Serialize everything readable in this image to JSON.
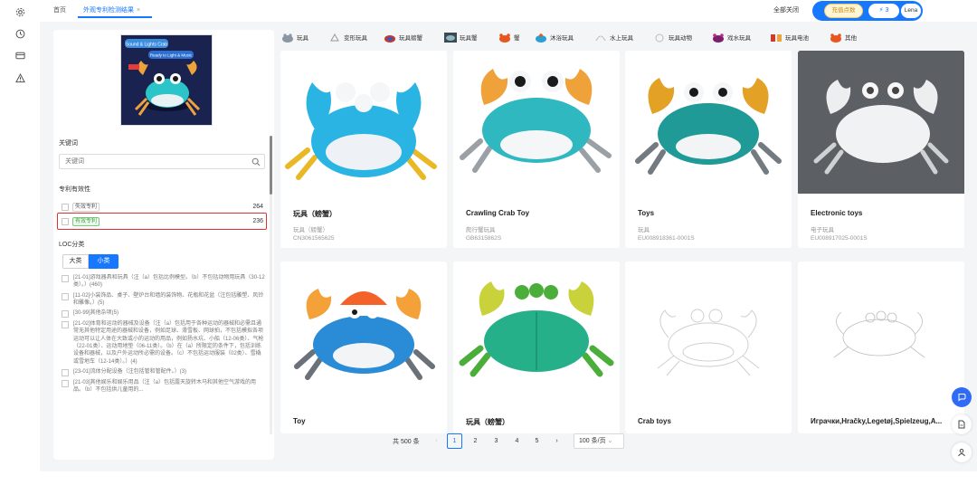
{
  "tabs": [
    {
      "label": "首页",
      "active": false
    },
    {
      "label": "外观专利检测结果",
      "active": true,
      "close": "×"
    }
  ],
  "top_right": {
    "close_all": "全部关闭",
    "points_label": "充值点数",
    "bolt_count": "3",
    "user": "Lena"
  },
  "filter": {
    "keyword_label": "关键词",
    "keyword_placeholder": "关键词",
    "validity_label": "专利有效性",
    "validity_options": [
      {
        "label": "失效专利",
        "count": "264"
      },
      {
        "label": "有效专利",
        "count": "236"
      }
    ],
    "loc_label": "LOC分类",
    "loc_tabs": [
      "大类",
      "小类"
    ],
    "loc_items": [
      "[21-01]游戏器具和玩具（注（a）包括比例模型。（b）不包括动物用玩具（30-12类）。）(460)",
      "[11-02]小装饰品、桌子、壁炉台和墙的装饰物、花瓶和花盆（注包括雕塑、风铃和雕像。）(5)",
      "[30-99]其他杂项(5)",
      "[21-02]体育和运动的器械及设备（注（a）包括用于各种运动的器械和必需且通常无其他特定用途的器械和设备，例如足球、滑雪板、网球拍，不包括模拟各项运动可以让人体在大致或小的运动的用品，例如扬水坑、小船（12-06类）、气枪（22-01类）、运动用地垫（06-11类）。（b）在（a）所限定的条件下，包括训练设备和器械，以及户外运动所必需的设备。（c）不包括运动服装（02类）、雪橇或雪地车（12-14类）。）(4)",
      "[23-01]流体分配设备（注包括管和管配件。）(3)",
      "[21-03]其他娱乐和娱乐用品（注（a）包括露天旋转木马和其他空气游戏的用品。（b）不包括供儿童用的..."
    ]
  },
  "categories": [
    {
      "label": "玩具",
      "icon": "crab-toy-icon"
    },
    {
      "label": "变形玩具",
      "icon": "transform-toy-icon"
    },
    {
      "label": "玩具螃蟹",
      "icon": "toy-crab-icon"
    },
    {
      "label": "玩具蟹",
      "icon": "toy-crab-icon"
    },
    {
      "label": "蟹",
      "icon": "crab-icon"
    },
    {
      "label": "沐浴玩具",
      "icon": "bath-toy-icon"
    },
    {
      "label": "水上玩具",
      "icon": "water-toy-icon"
    },
    {
      "label": "玩具动物",
      "icon": "animal-toy-icon"
    },
    {
      "label": "戏水玩具",
      "icon": "splash-toy-icon"
    },
    {
      "label": "玩具电池",
      "icon": "battery-toy-icon"
    },
    {
      "label": "其他",
      "icon": "other-icon"
    }
  ],
  "cards": [
    {
      "title": "玩具（螃蟹）",
      "category": "玩具（螃蟹）",
      "number": "CN3061565625",
      "style": "blue-yellow"
    },
    {
      "title": "Crawling Crab Toy",
      "category": "爬行蟹玩具",
      "number": "GB6315862S",
      "style": "teal-orange"
    },
    {
      "title": "Toys",
      "category": "玩具",
      "number": "EU008918361-0001S",
      "style": "teal-yellow"
    },
    {
      "title": "Electronic toys",
      "category": "电子玩具",
      "number": "EU008917025-0001S",
      "style": "grey-render"
    },
    {
      "title": "Toy",
      "category": "",
      "number": "",
      "style": "blue-orange"
    },
    {
      "title": "玩具（螃蟹）",
      "category": "",
      "number": "",
      "style": "green"
    },
    {
      "title": "Crab toys",
      "category": "",
      "number": "",
      "style": "line-art"
    },
    {
      "title": "Игрaчки,Hračky,Legetøj,Spielzeug,A...",
      "category": "",
      "number": "",
      "style": "line-art-2"
    }
  ],
  "pagination": {
    "total": "共 500 条",
    "pages": [
      "1",
      "2",
      "3",
      "4",
      "5"
    ],
    "current": "1",
    "prev": "‹",
    "next": "›",
    "per_page": "100 条/页"
  },
  "thumb": {
    "headline": "Sound & Lights Crab",
    "sub": "Ready to Light & Music"
  }
}
